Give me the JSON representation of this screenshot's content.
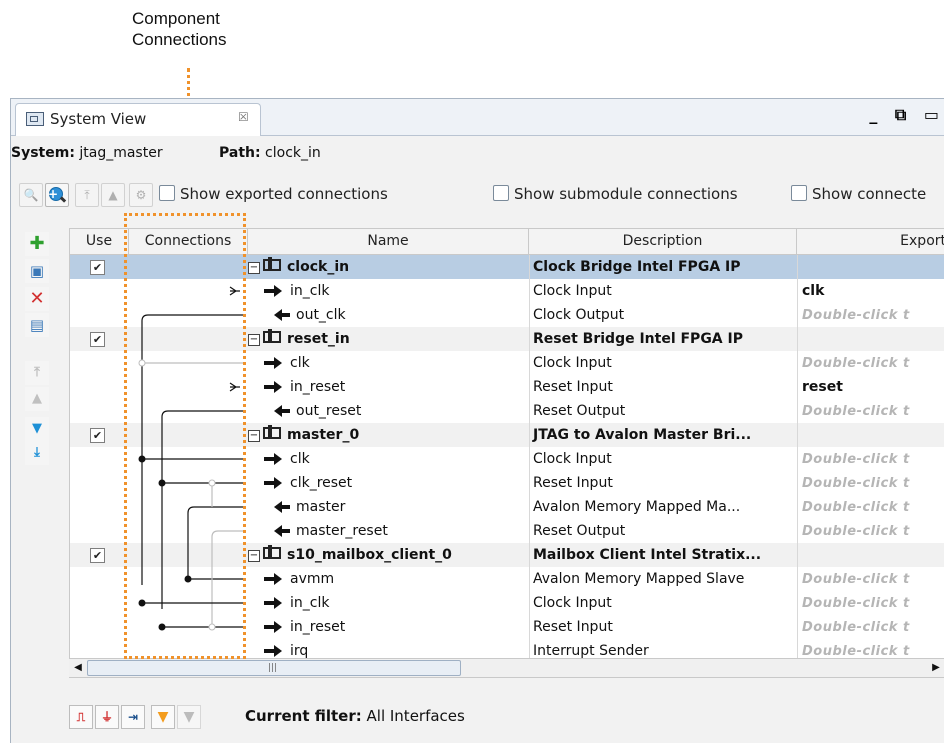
{
  "callout": {
    "line1": "Component",
    "line2": "Connections"
  },
  "tab": {
    "title": "System View",
    "close_glyph": "☒"
  },
  "window_controls": "_ ⧉ ▭",
  "system": {
    "label": "System:",
    "value": "jtag_master",
    "path_label": "Path:",
    "path_value": "clock_in"
  },
  "toolbar": {
    "checkboxes": [
      {
        "label": "Show exported connections",
        "checked": false
      },
      {
        "label": "Show submodule connections",
        "checked": false
      },
      {
        "label": "Show connecte",
        "checked": false
      }
    ]
  },
  "columns": {
    "use": "Use",
    "connections": "Connections",
    "name": "Name",
    "description": "Description",
    "export": "Export"
  },
  "rows": [
    {
      "kind": "component",
      "use": "✔",
      "name": "clock_in",
      "description": "Clock Bridge Intel FPGA IP",
      "export": "",
      "selected": true
    },
    {
      "kind": "in",
      "name": "in_clk",
      "description": "Clock Input",
      "export": "clk"
    },
    {
      "kind": "out",
      "name": "out_clk",
      "description": "Clock Output",
      "export": "Double-click t"
    },
    {
      "kind": "component",
      "use": "✔",
      "name": "reset_in",
      "description": "Reset Bridge Intel FPGA IP",
      "export": ""
    },
    {
      "kind": "in",
      "name": "clk",
      "description": "Clock Input",
      "export": "Double-click t"
    },
    {
      "kind": "in",
      "name": "in_reset",
      "description": "Reset Input",
      "export": "reset"
    },
    {
      "kind": "out",
      "name": "out_reset",
      "description": "Reset Output",
      "export": "Double-click t"
    },
    {
      "kind": "component",
      "use": "✔",
      "name": "master_0",
      "description": "JTAG to Avalon Master Bri...",
      "export": ""
    },
    {
      "kind": "in",
      "name": "clk",
      "description": "Clock Input",
      "export": "Double-click t"
    },
    {
      "kind": "in",
      "name": "clk_reset",
      "description": "Reset Input",
      "export": "Double-click t"
    },
    {
      "kind": "out",
      "name": "master",
      "description": "Avalon Memory Mapped Ma...",
      "export": "Double-click t"
    },
    {
      "kind": "out",
      "name": "master_reset",
      "description": "Reset Output",
      "export": "Double-click t"
    },
    {
      "kind": "component",
      "use": "✔",
      "name": "s10_mailbox_client_0",
      "description": "Mailbox Client Intel Stratix...",
      "export": ""
    },
    {
      "kind": "in",
      "name": "avmm",
      "description": "Avalon Memory Mapped Slave",
      "export": "Double-click t"
    },
    {
      "kind": "in",
      "name": "in_clk",
      "description": "Clock Input",
      "export": "Double-click t"
    },
    {
      "kind": "in",
      "name": "in_reset",
      "description": "Reset Input",
      "export": "Double-click t"
    },
    {
      "kind": "in",
      "name": "irq",
      "description": "Interrupt Sender",
      "export": "Double-click t"
    }
  ],
  "filter": {
    "label": "Current filter:",
    "value": "All Interfaces"
  },
  "colors": {
    "accent_dotted": "#f0922b",
    "selected_row": "#b8cde3"
  }
}
